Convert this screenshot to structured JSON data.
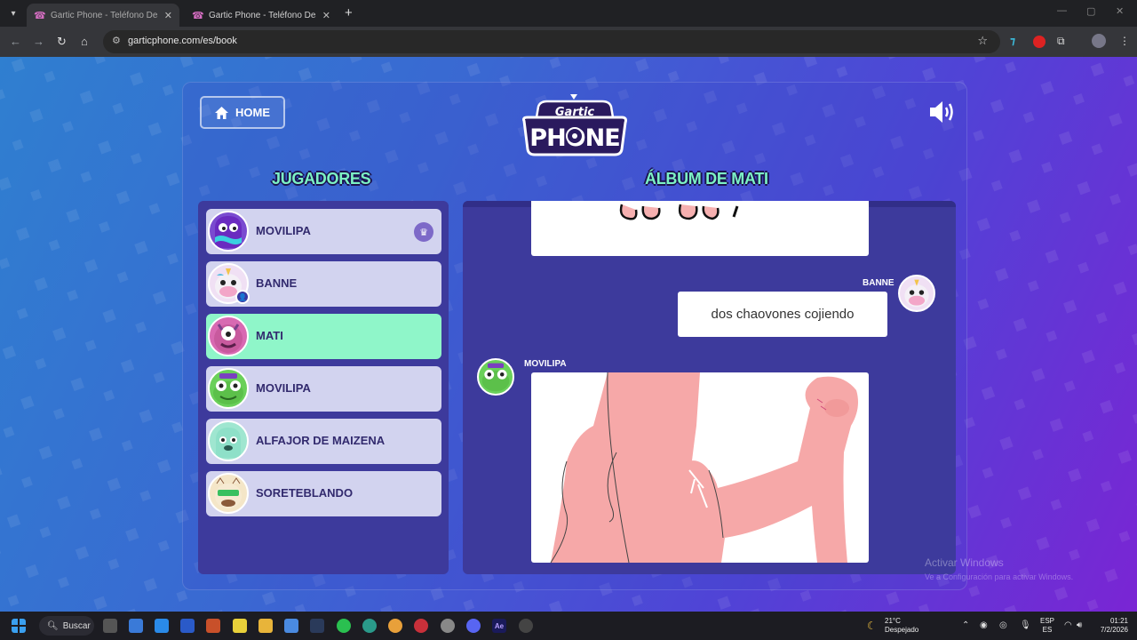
{
  "browser": {
    "tabs": [
      {
        "title": "Gartic Phone - Teléfono Descom"
      },
      {
        "title": "Gartic Phone - Teléfono Descom"
      }
    ],
    "url": "garticphone.com/es/book"
  },
  "page": {
    "home_label": "HOME",
    "players_heading": "JUGADORES",
    "album_heading": "ÁLBUM DE MATI",
    "players": [
      {
        "name": "MOVILIPA",
        "crown": true,
        "active": false
      },
      {
        "name": "BANNE",
        "crown": false,
        "active": false
      },
      {
        "name": "MATI",
        "crown": false,
        "active": true
      },
      {
        "name": "MOVILIPA",
        "crown": false,
        "active": false
      },
      {
        "name": "ALFAJOR DE MAIZENA",
        "crown": false,
        "active": false
      },
      {
        "name": "SORETEBLANDO",
        "crown": false,
        "active": false
      }
    ],
    "album": {
      "message_author": "BANNE",
      "message_text": "dos chaovones cojiendo",
      "drawing_author": "MOVILIPA"
    },
    "watermark": {
      "title": "Activar Windows",
      "subtitle": "Ve a Configuración para activar Windows."
    }
  },
  "taskbar": {
    "search_label": "Buscar",
    "weather_temp": "21°C",
    "weather_desc": "Despejado",
    "lang_top": "ESP",
    "lang_bottom": "ES",
    "time": "01:21",
    "date": "7/2/2026"
  },
  "colors": {
    "accent_green": "#8ff6c9",
    "heading_green": "#7cf2c4",
    "panel_dark": "#3d3a9c"
  }
}
